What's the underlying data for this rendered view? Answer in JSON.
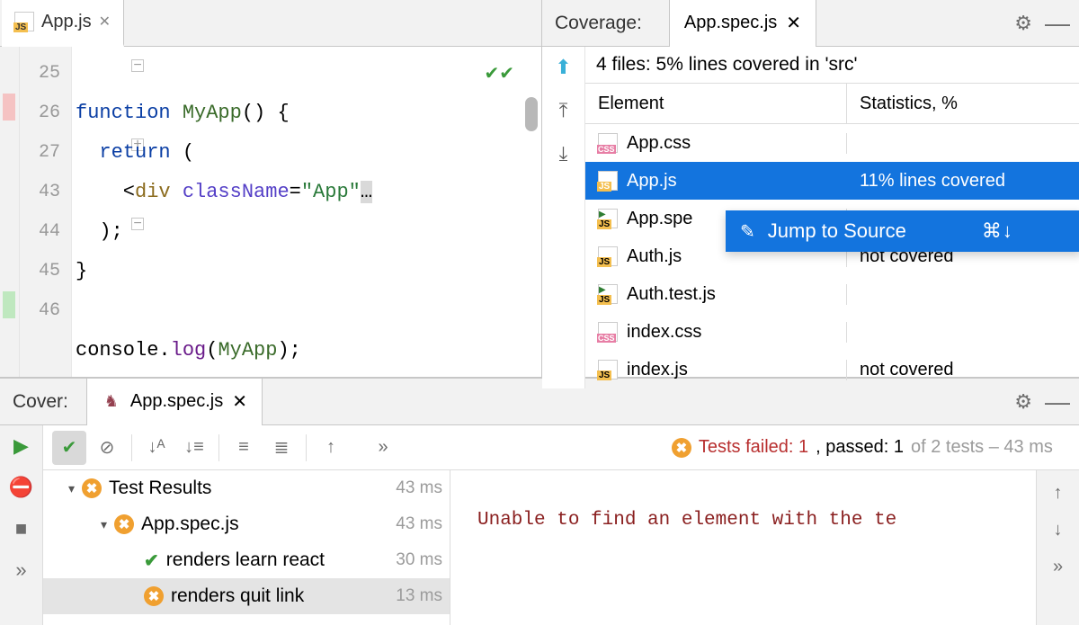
{
  "editor": {
    "tab_label": "App.js",
    "gutter_lines": [
      "25",
      "26",
      "27",
      "43",
      "44",
      "45",
      "46"
    ],
    "code_lines": [
      {
        "raw": "function MyApp() {",
        "tokens": [
          [
            "kw",
            "function"
          ],
          [
            "",
            ""
          ],
          [
            "fn",
            " MyApp"
          ],
          [
            "",
            "() {"
          ]
        ]
      },
      {
        "raw": "  return (",
        "tokens": [
          [
            "",
            "  "
          ],
          [
            "kw",
            "return"
          ],
          [
            "",
            " ("
          ]
        ]
      },
      {
        "raw": "    <div className=\"App\"…",
        "tokens": [
          [
            "",
            "    <"
          ],
          [
            "tag",
            "div"
          ],
          [
            "",
            " "
          ],
          [
            "attr",
            "className"
          ],
          [
            "",
            "="
          ],
          [
            "str",
            "\"App\""
          ],
          [
            "",
            "…"
          ]
        ]
      },
      {
        "raw": "  );",
        "tokens": [
          [
            "",
            "  );"
          ]
        ]
      },
      {
        "raw": "}",
        "tokens": [
          [
            "",
            "}"
          ]
        ]
      },
      {
        "raw": "",
        "tokens": [
          [
            "",
            ""
          ]
        ]
      },
      {
        "raw": "console.log(MyApp);",
        "tokens": [
          [
            "",
            "console."
          ],
          [
            "prop",
            "log"
          ],
          [
            "",
            "("
          ],
          [
            "fn",
            "MyApp"
          ],
          [
            "",
            ");"
          ]
        ]
      }
    ]
  },
  "coverage": {
    "panel_title": "Coverage:",
    "tab_label": "App.spec.js",
    "summary": "4 files: 5% lines covered in 'src'",
    "col_element": "Element",
    "col_stats": "Statistics, %",
    "rows": [
      {
        "icon": "css",
        "name": "App.css",
        "stat": ""
      },
      {
        "icon": "js",
        "name": "App.js",
        "stat": "11% lines covered",
        "selected": true
      },
      {
        "icon": "test",
        "name": "App.spe",
        "stat": ""
      },
      {
        "icon": "js",
        "name": "Auth.js",
        "stat": "not covered"
      },
      {
        "icon": "test",
        "name": "Auth.test.js",
        "stat": ""
      },
      {
        "icon": "css",
        "name": "index.css",
        "stat": ""
      },
      {
        "icon": "js",
        "name": "index.js",
        "stat": "not covered"
      }
    ],
    "context_label": "Jump to Source",
    "context_shortcut": "⌘↓"
  },
  "cover_panel": {
    "panel_title": "Cover:",
    "tab_label": "App.spec.js",
    "status_failed_label": "Tests failed: 1",
    "status_passed_label": ", passed: 1",
    "status_of_label": " of 2 tests – 43 ms",
    "output_line": "Unable to find an element with the te",
    "tree": {
      "root": {
        "label": "Test Results",
        "dur": "43 ms"
      },
      "suite": {
        "label": "App.spec.js",
        "dur": "43 ms"
      },
      "test_pass": {
        "label": "renders learn react",
        "dur": "30 ms"
      },
      "test_fail": {
        "label": "renders quit link",
        "dur": "13 ms"
      }
    }
  },
  "icons": {
    "gear": "⚙",
    "minimize": "—",
    "close": "✕",
    "up_arrow": "↑",
    "down_arrow": "↓",
    "chevron_dbl": "»"
  }
}
